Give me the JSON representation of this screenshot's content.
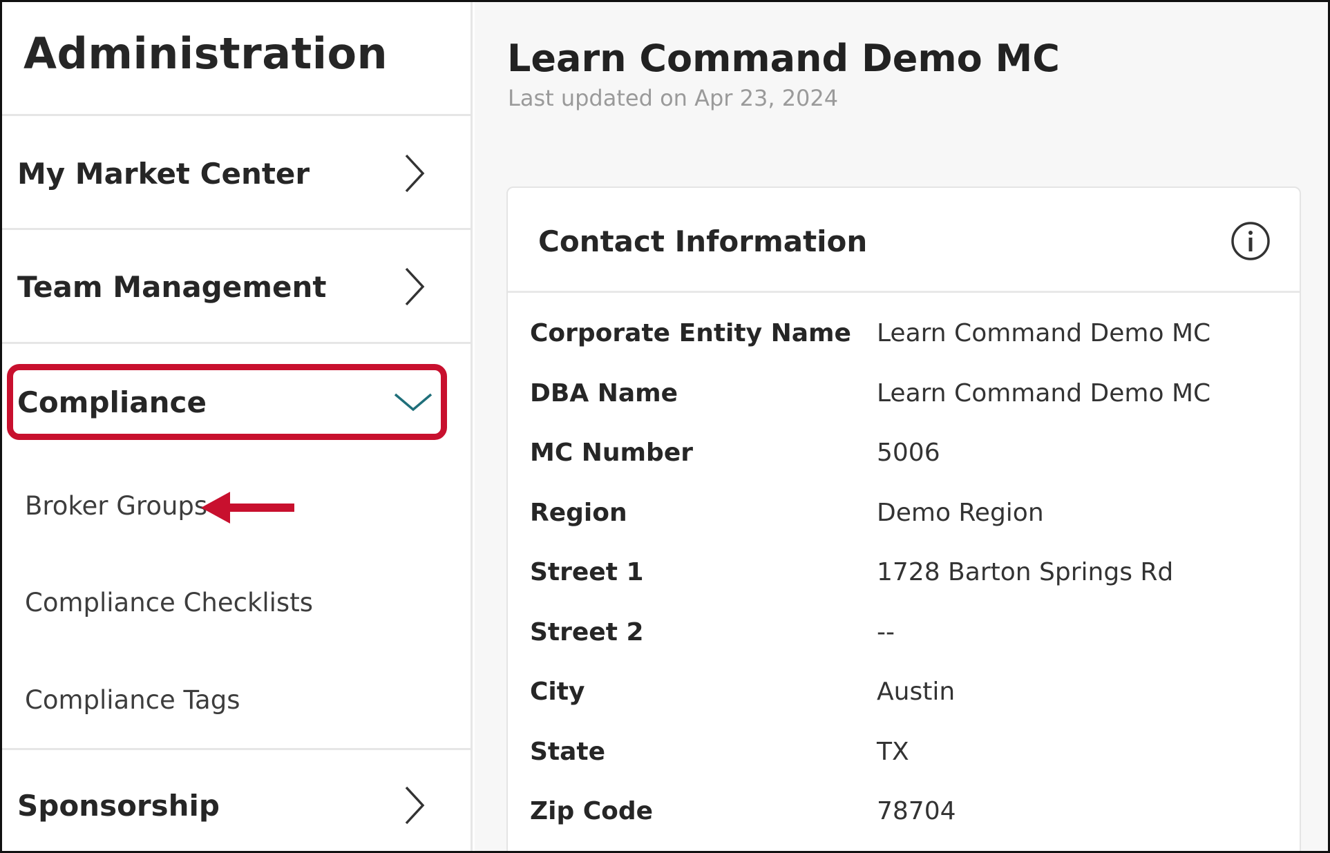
{
  "sidebar": {
    "title": "Administration",
    "items": [
      {
        "label": "My Market Center",
        "icon": "chevron-right-icon"
      },
      {
        "label": "Team Management",
        "icon": "chevron-right-icon"
      },
      {
        "label": "Compliance",
        "icon": "chevron-down-icon",
        "expanded": true
      },
      {
        "label": "Sponsorship",
        "icon": "chevron-right-icon"
      }
    ],
    "compliance_subitems": [
      {
        "label": "Broker Groups"
      },
      {
        "label": "Compliance Checklists"
      },
      {
        "label": "Compliance Tags"
      }
    ]
  },
  "main": {
    "title": "Learn Command Demo MC",
    "subtitle": "Last updated on Apr 23, 2024",
    "card": {
      "title": "Contact Information",
      "info_icon": "info-icon",
      "fields": [
        {
          "label": "Corporate Entity Name",
          "value": "Learn Command Demo MC"
        },
        {
          "label": "DBA Name",
          "value": "Learn Command Demo MC"
        },
        {
          "label": "MC Number",
          "value": "5006"
        },
        {
          "label": "Region",
          "value": "Demo Region"
        },
        {
          "label": "Street 1",
          "value": "1728 Barton Springs Rd"
        },
        {
          "label": "Street 2",
          "value": "--"
        },
        {
          "label": "City",
          "value": "Austin"
        },
        {
          "label": "State",
          "value": "TX"
        },
        {
          "label": "Zip Code",
          "value": "78704"
        }
      ]
    }
  },
  "colors": {
    "highlight": "#c8102e",
    "accent_chevron": "#1f6f7a",
    "muted_text": "#9a9a9a"
  }
}
